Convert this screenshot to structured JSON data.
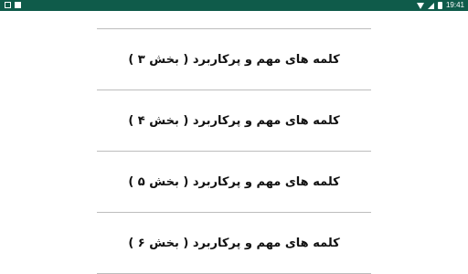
{
  "status_bar": {
    "time": "19:41",
    "left_icons": [
      "screenshot-icon",
      "download-icon"
    ],
    "right_icons": [
      "wifi-icon",
      "signal-icon",
      "battery-icon"
    ]
  },
  "items": [
    {
      "label": "کلمه های مهم و پرکاربرد ( بخش ۳ )"
    },
    {
      "label": "کلمه های مهم و پرکاربرد ( بخش ۴ )"
    },
    {
      "label": "کلمه های مهم و پرکاربرد ( بخش ۵ )"
    },
    {
      "label": "کلمه های مهم و پرکاربرد ( بخش ۶ )"
    }
  ]
}
